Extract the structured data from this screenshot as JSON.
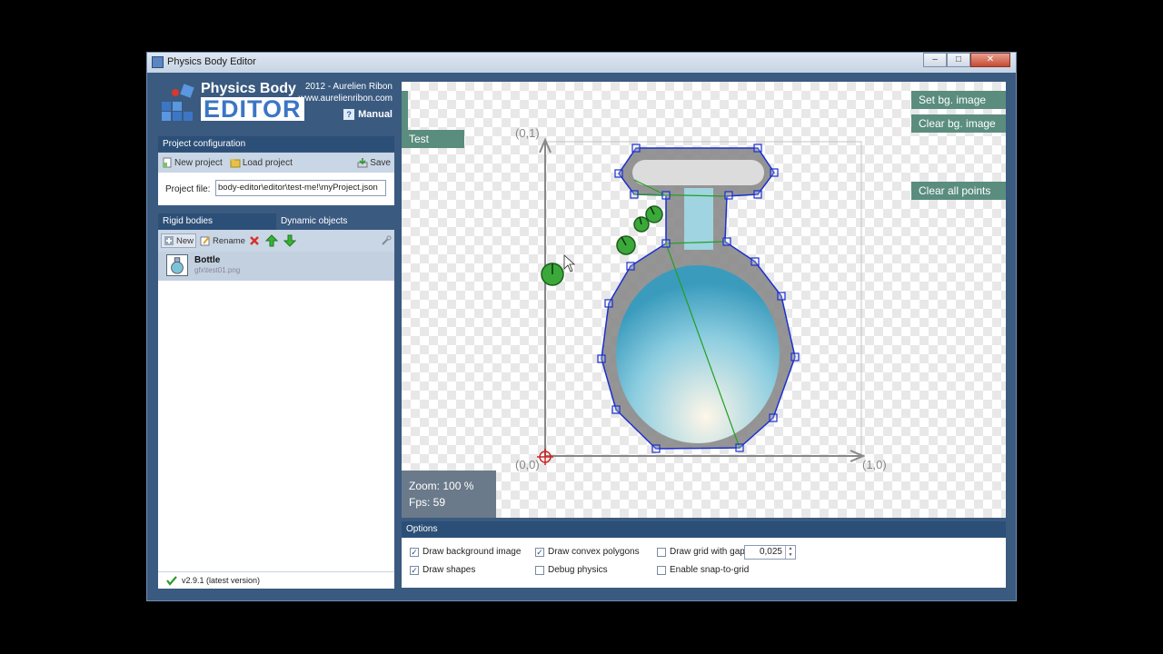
{
  "window": {
    "title": "Physics Body Editor"
  },
  "logo": {
    "title_line1": "Physics Body",
    "title_line2": "EDITOR",
    "year_author": "2012 - Aurelien Ribon",
    "url": "www.aurelienribon.com",
    "manual_label": "Manual"
  },
  "project": {
    "header": "Project configuration",
    "new_label": "New project",
    "load_label": "Load project",
    "save_label": "Save",
    "file_label": "Project file:",
    "file_value": "body-editor\\editor\\test-me!\\myProject.json"
  },
  "tabs": {
    "rigid_bodies": "Rigid bodies",
    "dynamic_objects": "Dynamic objects"
  },
  "bodies_toolbar": {
    "new_label": "New",
    "rename_label": "Rename"
  },
  "bodies": [
    {
      "name": "Bottle",
      "path": "gfx\\test01.png"
    }
  ],
  "status": {
    "version": "v2.9.1 (latest version)"
  },
  "canvas": {
    "test_label": "Test",
    "set_bg_label": "Set bg. image",
    "clear_bg_label": "Clear bg. image",
    "clear_points_label": "Clear all points",
    "zoom_text": "Zoom: 100 %",
    "fps_text": "Fps: 59",
    "coord_01": "(0,1)",
    "coord_00": "(0,0)",
    "coord_10": "(1,0)"
  },
  "options": {
    "header": "Options",
    "draw_bg_image": {
      "label": "Draw background image",
      "checked": true
    },
    "draw_shapes": {
      "label": "Draw shapes",
      "checked": true
    },
    "draw_convex": {
      "label": "Draw convex polygons",
      "checked": true
    },
    "debug_physics": {
      "label": "Debug physics",
      "checked": false
    },
    "draw_grid": {
      "label": "Draw grid with gap",
      "checked": false
    },
    "snap_grid": {
      "label": "Enable snap-to-grid",
      "checked": false
    },
    "grid_gap": "0,025"
  },
  "colors": {
    "accent": "#2c4f77",
    "canvas_button": "#5a8d7e",
    "shape_outline": "#1a2fd0",
    "convex_line": "#22a022",
    "background": "#3a5a80"
  }
}
